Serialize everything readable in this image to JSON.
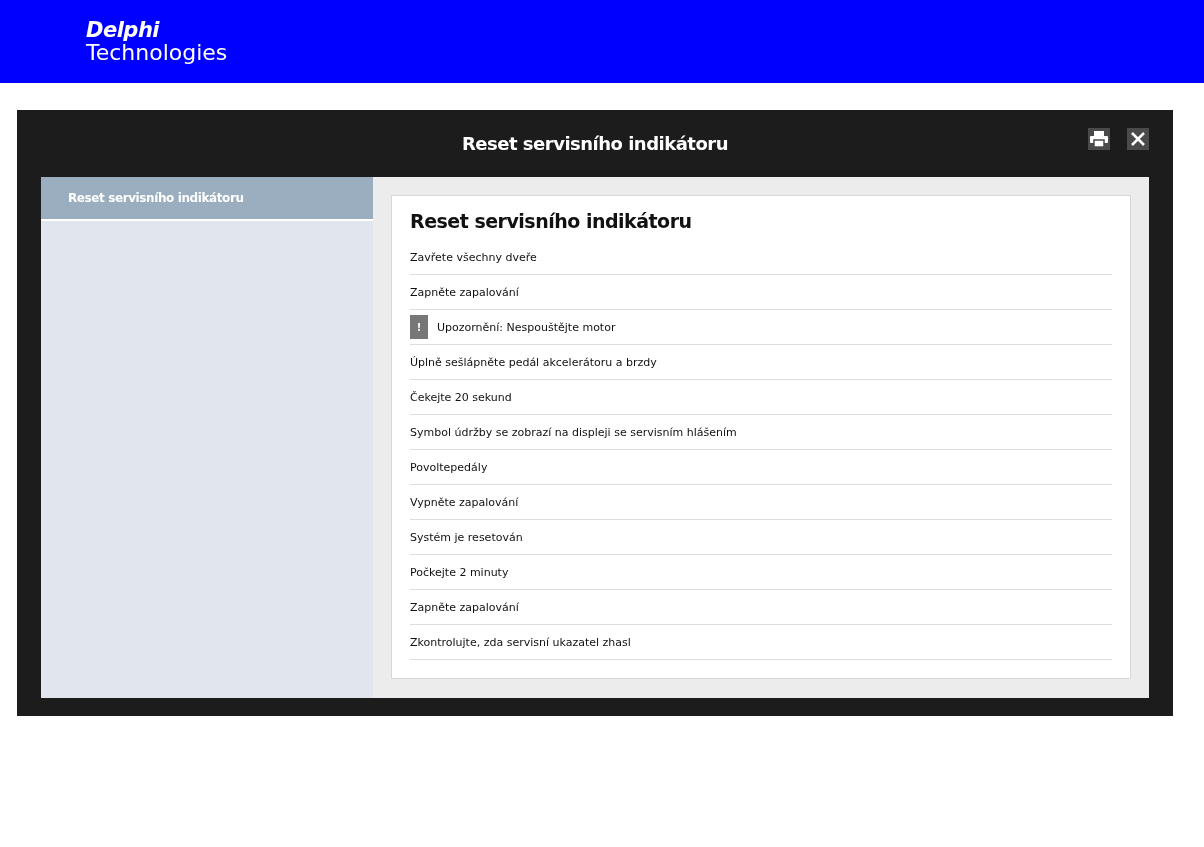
{
  "header": {
    "logo_line_1": "Delphi",
    "logo_line_2": "Technologies"
  },
  "dialog": {
    "title": "Reset servisního indikátoru"
  },
  "sidebar": {
    "items": [
      {
        "label": "Reset servisního indikátoru",
        "selected": true
      }
    ]
  },
  "content": {
    "heading": "Reset servisního indikátoru",
    "steps": [
      {
        "kind": "step",
        "text": "Zavřete všechny dveře"
      },
      {
        "kind": "step",
        "text": "Zapněte zapalování"
      },
      {
        "kind": "warning",
        "icon": "!",
        "text": "Upozornění: Nespouštějte motor"
      },
      {
        "kind": "step",
        "text": "Úplně sešlápněte pedál akcelerátoru a brzdy"
      },
      {
        "kind": "step",
        "text": "Čekejte 20 sekund"
      },
      {
        "kind": "step",
        "text": "Symbol údržby se zobrazí na displeji se servisním hlášením"
      },
      {
        "kind": "step",
        "text": "Povoltepedály"
      },
      {
        "kind": "step",
        "text": "Vypněte zapalování"
      },
      {
        "kind": "step",
        "text": "Systém je resetován"
      },
      {
        "kind": "step",
        "text": "Počkejte 2 minuty"
      },
      {
        "kind": "step",
        "text": "Zapněte zapalování"
      },
      {
        "kind": "step",
        "text": "Zkontrolujte, zda servisní ukazatel zhasl"
      }
    ]
  }
}
